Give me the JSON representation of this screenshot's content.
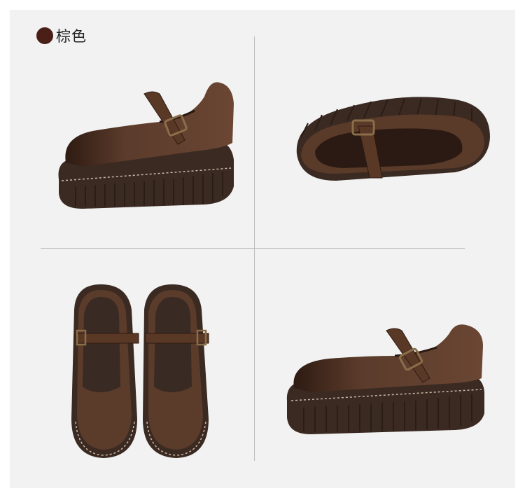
{
  "legend": {
    "label": "棕色",
    "swatch_color": "#4a1f17"
  },
  "colors": {
    "background": "#f2f2f2",
    "leather": "#5a3a2a",
    "leather_dark": "#3a2418",
    "sole": "#3b2a22"
  }
}
